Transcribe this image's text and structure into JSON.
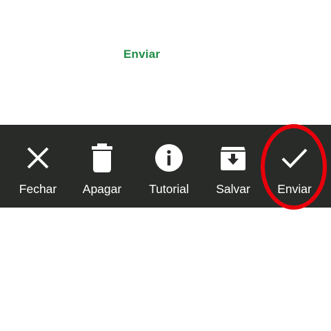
{
  "caption": {
    "text": "Enviar",
    "color": "#1e8c45"
  },
  "toolbar": {
    "background": "#282b28",
    "items": [
      {
        "id": "fechar",
        "label": "Fechar",
        "icon": "close-icon"
      },
      {
        "id": "apagar",
        "label": "Apagar",
        "icon": "trash-icon"
      },
      {
        "id": "tutorial",
        "label": "Tutorial",
        "icon": "info-icon"
      },
      {
        "id": "salvar",
        "label": "Salvar",
        "icon": "archive-download-icon"
      },
      {
        "id": "enviar",
        "label": "Enviar",
        "icon": "check-icon"
      }
    ]
  },
  "highlight": {
    "target": "enviar",
    "color": "#e8000b"
  }
}
